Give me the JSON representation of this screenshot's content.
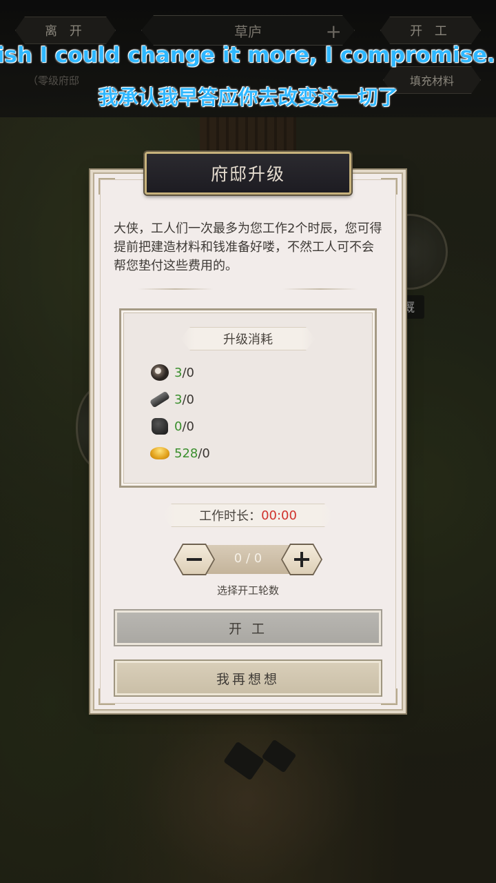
{
  "topbar": {
    "leave_label": "离 开",
    "location_title": "草庐",
    "start_label": "开 工",
    "sub_text": "（零级府邸",
    "fill_label": "填充材料"
  },
  "background": {
    "building_label": "厩"
  },
  "subtitles": {
    "en": "wish I could change it more, I compromise.",
    "zh": "我承认我早答应你去改变这一切了"
  },
  "dialog": {
    "title": "府邸升级",
    "description": "大侠，工人们一次最多为您工作2个时辰，您可得提前把建造材料和钱准备好喽，不然工人可不会帮您垫付这些费用的。",
    "cost_header": "升级消耗",
    "resources": [
      {
        "icon": "stone-icon",
        "have": "3",
        "need": "/0"
      },
      {
        "icon": "wood-icon",
        "have": "3",
        "need": "/0"
      },
      {
        "icon": "iron-icon",
        "have": "0",
        "need": "/0"
      },
      {
        "icon": "gold-ingot-icon",
        "have": "528",
        "need": "/0"
      }
    ],
    "duration_label": "工作时长：",
    "duration_value": "00:00",
    "stepper_value": "0 / 0",
    "stepper_label": "选择开工轮数",
    "start_button": "开 工",
    "cancel_button": "我再想想"
  },
  "colors": {
    "dialog_bg": "#f2ecea",
    "resource_have": "#3a8f2d",
    "timer": "#d0322c",
    "subtitle": "#2fb7ff"
  }
}
